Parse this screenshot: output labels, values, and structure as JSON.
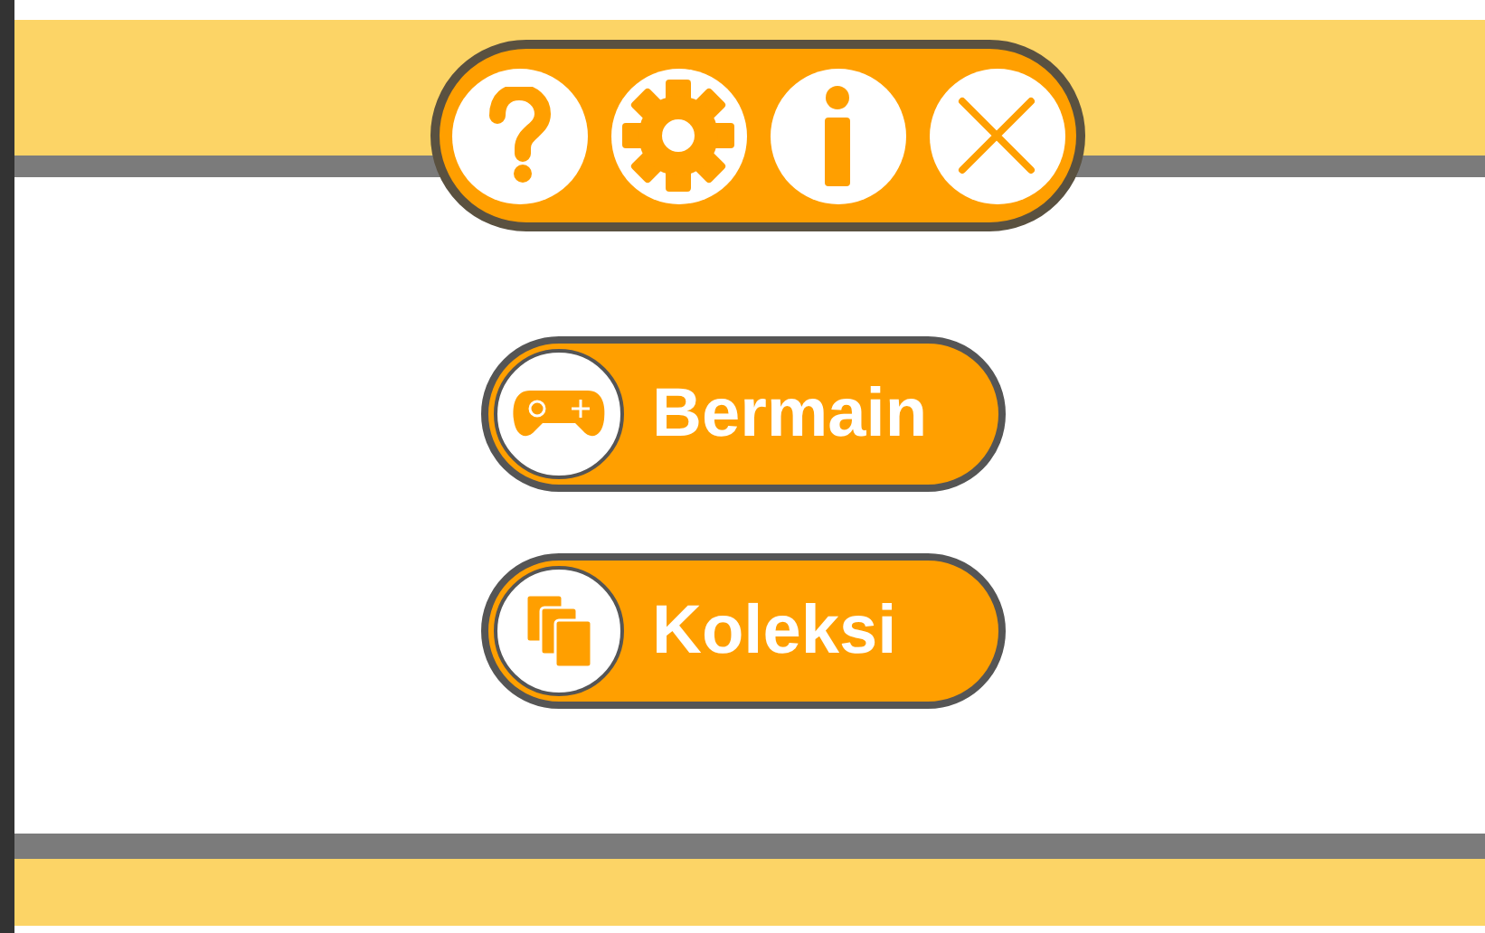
{
  "toolbar": {
    "buttons": [
      {
        "kind": "help"
      },
      {
        "kind": "settings"
      },
      {
        "kind": "info"
      },
      {
        "kind": "close"
      }
    ]
  },
  "menu": [
    {
      "label": "Bermain",
      "kind": "play"
    },
    {
      "label": "Koleksi",
      "kind": "collection"
    }
  ]
}
